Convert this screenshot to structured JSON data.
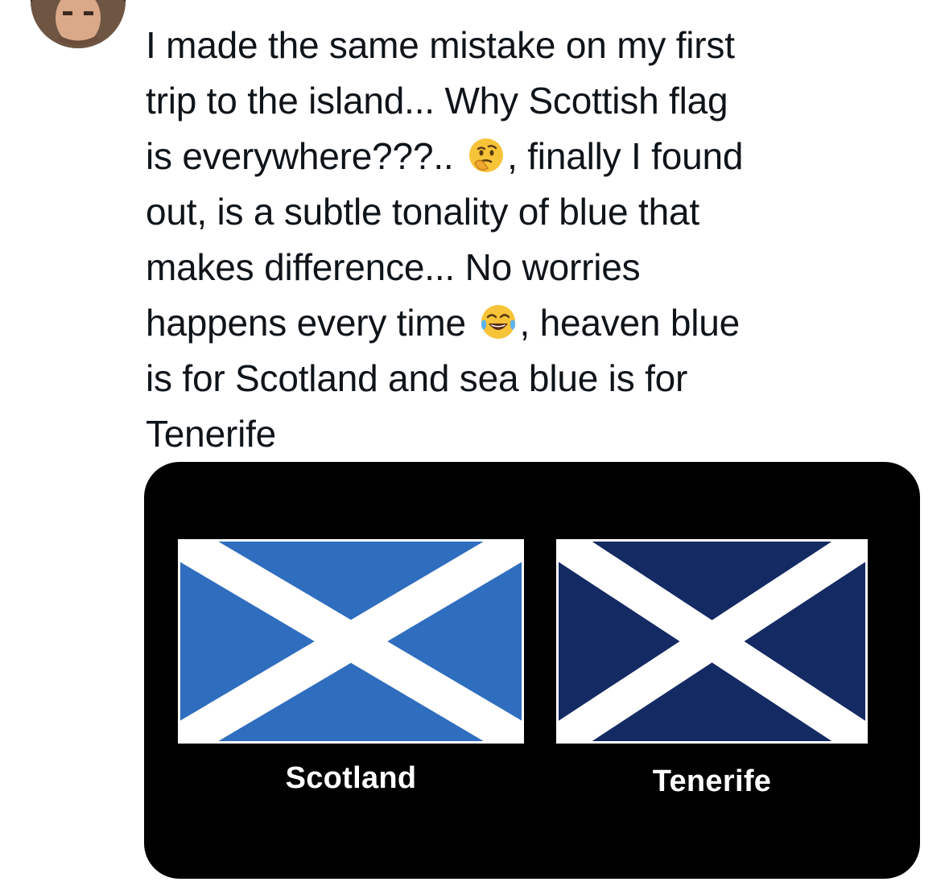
{
  "tweet": {
    "lines": [
      "I made the same mistake on my first",
      "trip to the island... Why Scottish flag",
      "is everywhere???.. ",
      ", finally I found",
      "out, is a subtle tonality of blue that",
      "makes difference... No worries",
      "happens every time ",
      ", heaven blue",
      "is for Scotland and sea blue is for",
      "Tenerife"
    ],
    "emojis": [
      "thinking-face-emoji",
      "tears-of-joy-emoji"
    ]
  },
  "media": {
    "flags": [
      {
        "label": "Scotland",
        "color": "#2f6dbe",
        "cross_color": "#ffffff"
      },
      {
        "label": "Tenerife",
        "color": "#142a63",
        "cross_color": "#ffffff"
      }
    ],
    "background": "#000000"
  }
}
